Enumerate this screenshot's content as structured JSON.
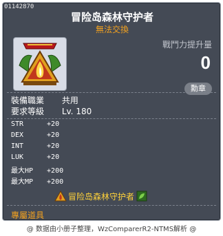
{
  "item": {
    "code": "01142870",
    "name": "冒险岛森林守护者",
    "trade_status": "無法交換",
    "icon_name": "forest-guardian-medal-icon"
  },
  "power": {
    "label": "戰鬥力提升量",
    "value": "0"
  },
  "medal_button_label": "勳章",
  "info": [
    {
      "label": "裝備職業",
      "value": "共用"
    },
    {
      "label": "要求等級",
      "value": "Lv. 180"
    }
  ],
  "stats": [
    {
      "label": "STR",
      "value": "+20"
    },
    {
      "label": "DEX",
      "value": "+20"
    },
    {
      "label": "INT",
      "value": "+20"
    },
    {
      "label": "LUK",
      "value": "+20"
    },
    {
      "label": "最大HP",
      "value": "+200"
    },
    {
      "label": "最大MP",
      "value": "+200"
    }
  ],
  "set_name": "冒险岛森林守护者",
  "exclusive_label": "專屬道具",
  "source_text": "@ 数据由小册子整理，WzComparerR2-NTMS解析 @",
  "colors": {
    "background": "#444a55",
    "name": "#ffffff",
    "trade_status": "#f0a020",
    "set_name": "#ffd23a"
  }
}
